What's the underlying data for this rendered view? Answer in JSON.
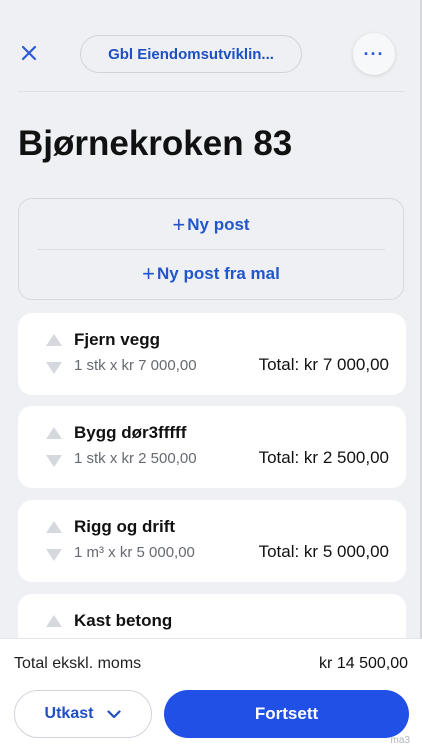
{
  "header": {
    "company": "Gbl Eiendomsutviklin...",
    "more_label": "···"
  },
  "page": {
    "title": "Bjørnekroken 83"
  },
  "add_actions": {
    "plus": "+",
    "new_post": "Ny post",
    "new_post_from_template": "Ny post fra mal"
  },
  "items": [
    {
      "name": "Fjern vegg",
      "qty": "1 stk x kr 7 000,00",
      "total": "Total: kr 7 000,00"
    },
    {
      "name": "Bygg dør3fffff",
      "qty": "1 stk x kr 2 500,00",
      "total": "Total: kr 2 500,00"
    },
    {
      "name": "Rigg og drift",
      "qty": "1 m³ x kr 5 000,00",
      "total": "Total: kr 5 000,00"
    },
    {
      "name": "Kast betong",
      "qty": "",
      "total": ""
    }
  ],
  "footer": {
    "sum_label": "Total ekskl. moms",
    "sum_value": "kr 14 500,00",
    "draft_label": "Utkast",
    "continue_label": "Fortsett"
  },
  "watermark": "ma3",
  "colors": {
    "accent": "#2050e6",
    "link": "#2256cc",
    "background": "#eef0f3"
  }
}
